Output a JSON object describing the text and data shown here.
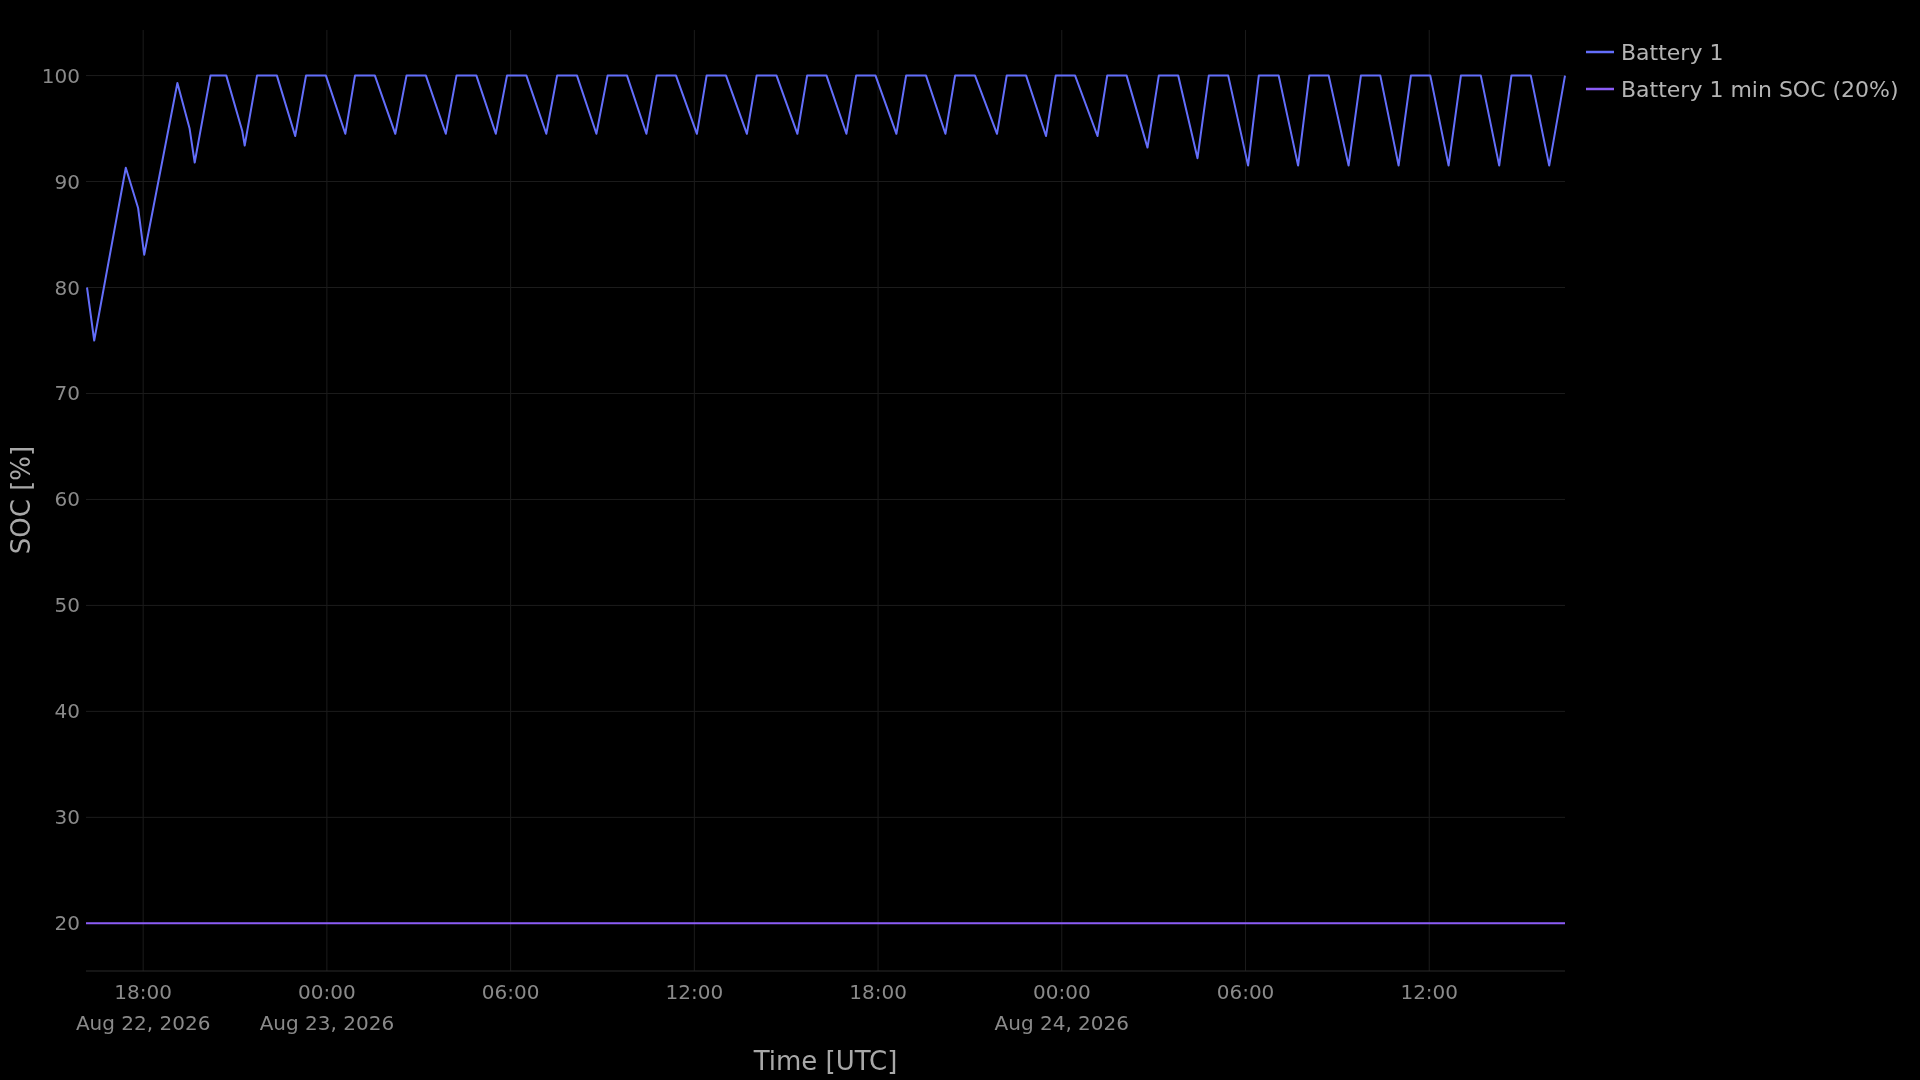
{
  "chart_data": {
    "type": "line",
    "xlabel": "Time [UTC]",
    "ylabel": "SOC [%]",
    "xlim": [
      "2026-08-22 16:08",
      "2026-08-24 16:26"
    ],
    "ylim": [
      15.5,
      104.3
    ],
    "xticks": [
      {
        "value": "2026-08-22 18:00",
        "label": "18:00\nAug 22, 2026"
      },
      {
        "value": "2026-08-23 00:00",
        "label": "00:00\nAug 23, 2026"
      },
      {
        "value": "2026-08-23 06:00",
        "label": "06:00"
      },
      {
        "value": "2026-08-23 12:00",
        "label": "12:00"
      },
      {
        "value": "2026-08-23 18:00",
        "label": "18:00"
      },
      {
        "value": "2026-08-24 00:00",
        "label": "00:00\nAug 24, 2026"
      },
      {
        "value": "2026-08-24 06:00",
        "label": "06:00"
      },
      {
        "value": "2026-08-24 12:00",
        "label": "12:00"
      }
    ],
    "yticks": [
      20,
      30,
      40,
      50,
      60,
      70,
      80,
      90,
      100
    ],
    "grid": true,
    "legend": "right",
    "series": [
      {
        "name": "Battery 1",
        "color": "#636efa",
        "x": [
          "2026-08-22 16:10",
          "2026-08-22 16:24",
          "2026-08-22 17:26",
          "2026-08-22 17:50",
          "2026-08-22 18:02",
          "2026-08-22 19:07",
          "2026-08-22 19:31",
          "2026-08-22 19:41",
          "2026-08-22 20:12",
          "2026-08-22 20:43",
          "2026-08-22 21:14",
          "2026-08-22 21:19",
          "2026-08-22 21:43",
          "2026-08-22 22:22",
          "2026-08-22 22:58",
          "2026-08-22 23:19",
          "2026-08-22 23:58",
          "2026-08-23 00:36",
          "2026-08-23 00:55",
          "2026-08-23 01:34",
          "2026-08-23 02:14",
          "2026-08-23 02:36",
          "2026-08-23 03:14",
          "2026-08-23 03:53",
          "2026-08-23 04:14",
          "2026-08-23 04:53",
          "2026-08-23 05:31",
          "2026-08-23 05:53",
          "2026-08-23 06:31",
          "2026-08-23 07:10",
          "2026-08-23 07:31",
          "2026-08-23 08:10",
          "2026-08-23 08:48",
          "2026-08-23 09:10",
          "2026-08-23 09:48",
          "2026-08-23 10:26",
          "2026-08-23 10:46",
          "2026-08-23 11:24",
          "2026-08-23 12:05",
          "2026-08-23 12:24",
          "2026-08-23 13:02",
          "2026-08-23 13:43",
          "2026-08-23 14:02",
          "2026-08-23 14:41",
          "2026-08-23 15:22",
          "2026-08-23 15:41",
          "2026-08-23 16:19",
          "2026-08-23 16:58",
          "2026-08-23 17:17",
          "2026-08-23 17:55",
          "2026-08-23 18:36",
          "2026-08-23 18:55",
          "2026-08-23 19:34",
          "2026-08-23 20:12",
          "2026-08-23 20:31",
          "2026-08-23 21:10",
          "2026-08-23 21:53",
          "2026-08-23 22:12",
          "2026-08-23 22:50",
          "2026-08-23 23:29",
          "2026-08-23 23:48",
          "2026-08-24 00:26",
          "2026-08-24 01:10",
          "2026-08-24 01:29",
          "2026-08-24 02:07",
          "2026-08-24 02:48",
          "2026-08-24 03:10",
          "2026-08-24 03:48",
          "2026-08-24 04:26",
          "2026-08-24 04:48",
          "2026-08-24 05:26",
          "2026-08-24 06:05",
          "2026-08-24 06:26",
          "2026-08-24 07:05",
          "2026-08-24 07:43",
          "2026-08-24 08:05",
          "2026-08-24 08:43",
          "2026-08-24 09:22",
          "2026-08-24 09:46",
          "2026-08-24 10:24",
          "2026-08-24 11:00",
          "2026-08-24 11:24",
          "2026-08-24 12:02",
          "2026-08-24 12:38",
          "2026-08-24 13:02",
          "2026-08-24 13:41",
          "2026-08-24 14:17",
          "2026-08-24 14:41",
          "2026-08-24 15:19",
          "2026-08-24 15:55",
          "2026-08-24 16:26"
        ],
        "values": [
          80,
          75,
          91.3,
          87.5,
          83.1,
          99.3,
          95,
          91.8,
          100,
          100,
          94.8,
          93.4,
          100,
          100,
          94.3,
          100,
          100,
          94.5,
          100,
          100,
          94.5,
          100,
          100,
          94.5,
          100,
          100,
          94.5,
          100,
          100,
          94.5,
          100,
          100,
          94.5,
          100,
          100,
          94.5,
          100,
          100,
          94.5,
          100,
          100,
          94.5,
          100,
          100,
          94.5,
          100,
          100,
          94.5,
          100,
          100,
          94.5,
          100,
          100,
          94.5,
          100,
          100,
          94.5,
          100,
          100,
          94.3,
          100,
          100,
          94.3,
          100,
          100,
          93.2,
          100,
          100,
          92.2,
          100,
          100,
          91.5,
          100,
          100,
          91.5,
          100,
          100,
          91.5,
          100,
          100,
          91.5,
          100,
          100,
          91.5,
          100,
          100,
          91.5,
          100,
          100,
          91.5,
          100
        ]
      },
      {
        "name": "Battery 1 min SOC (20%)",
        "color": "#8b5cf6",
        "x": [
          "2026-08-22 16:08",
          "2026-08-24 16:26"
        ],
        "values": [
          20,
          20
        ]
      }
    ]
  }
}
